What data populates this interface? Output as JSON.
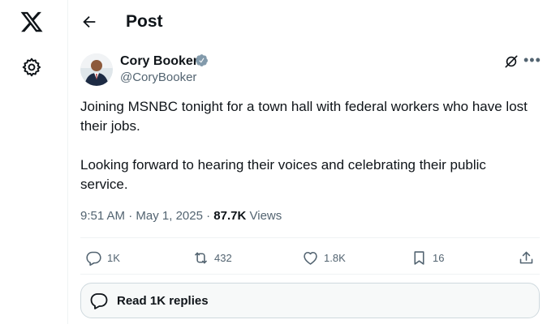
{
  "nav": {
    "logo_icon": "x-logo-icon",
    "settings_icon": "gear-icon"
  },
  "header": {
    "title": "Post",
    "back_icon": "arrow-left-icon"
  },
  "post": {
    "author_name": "Cory Booker",
    "author_handle": "@CoryBooker",
    "verified_color": "#829aab",
    "text_paragraphs": [
      "Joining MSNBC tonight for a town hall with federal workers who have lost their jobs.",
      "Looking forward to hearing their voices and celebrating their public service."
    ],
    "time": "9:51 AM",
    "date": "May 1, 2025",
    "views_count": "87.7K",
    "views_label": "Views"
  },
  "actions": {
    "replies": "1K",
    "reposts": "432",
    "likes": "1.8K",
    "bookmarks": "16"
  },
  "replies_button": {
    "label": "Read 1K replies"
  },
  "colors": {
    "secondary_text": "#536471",
    "primary_text": "#0f1419",
    "border": "#eff3f4"
  }
}
